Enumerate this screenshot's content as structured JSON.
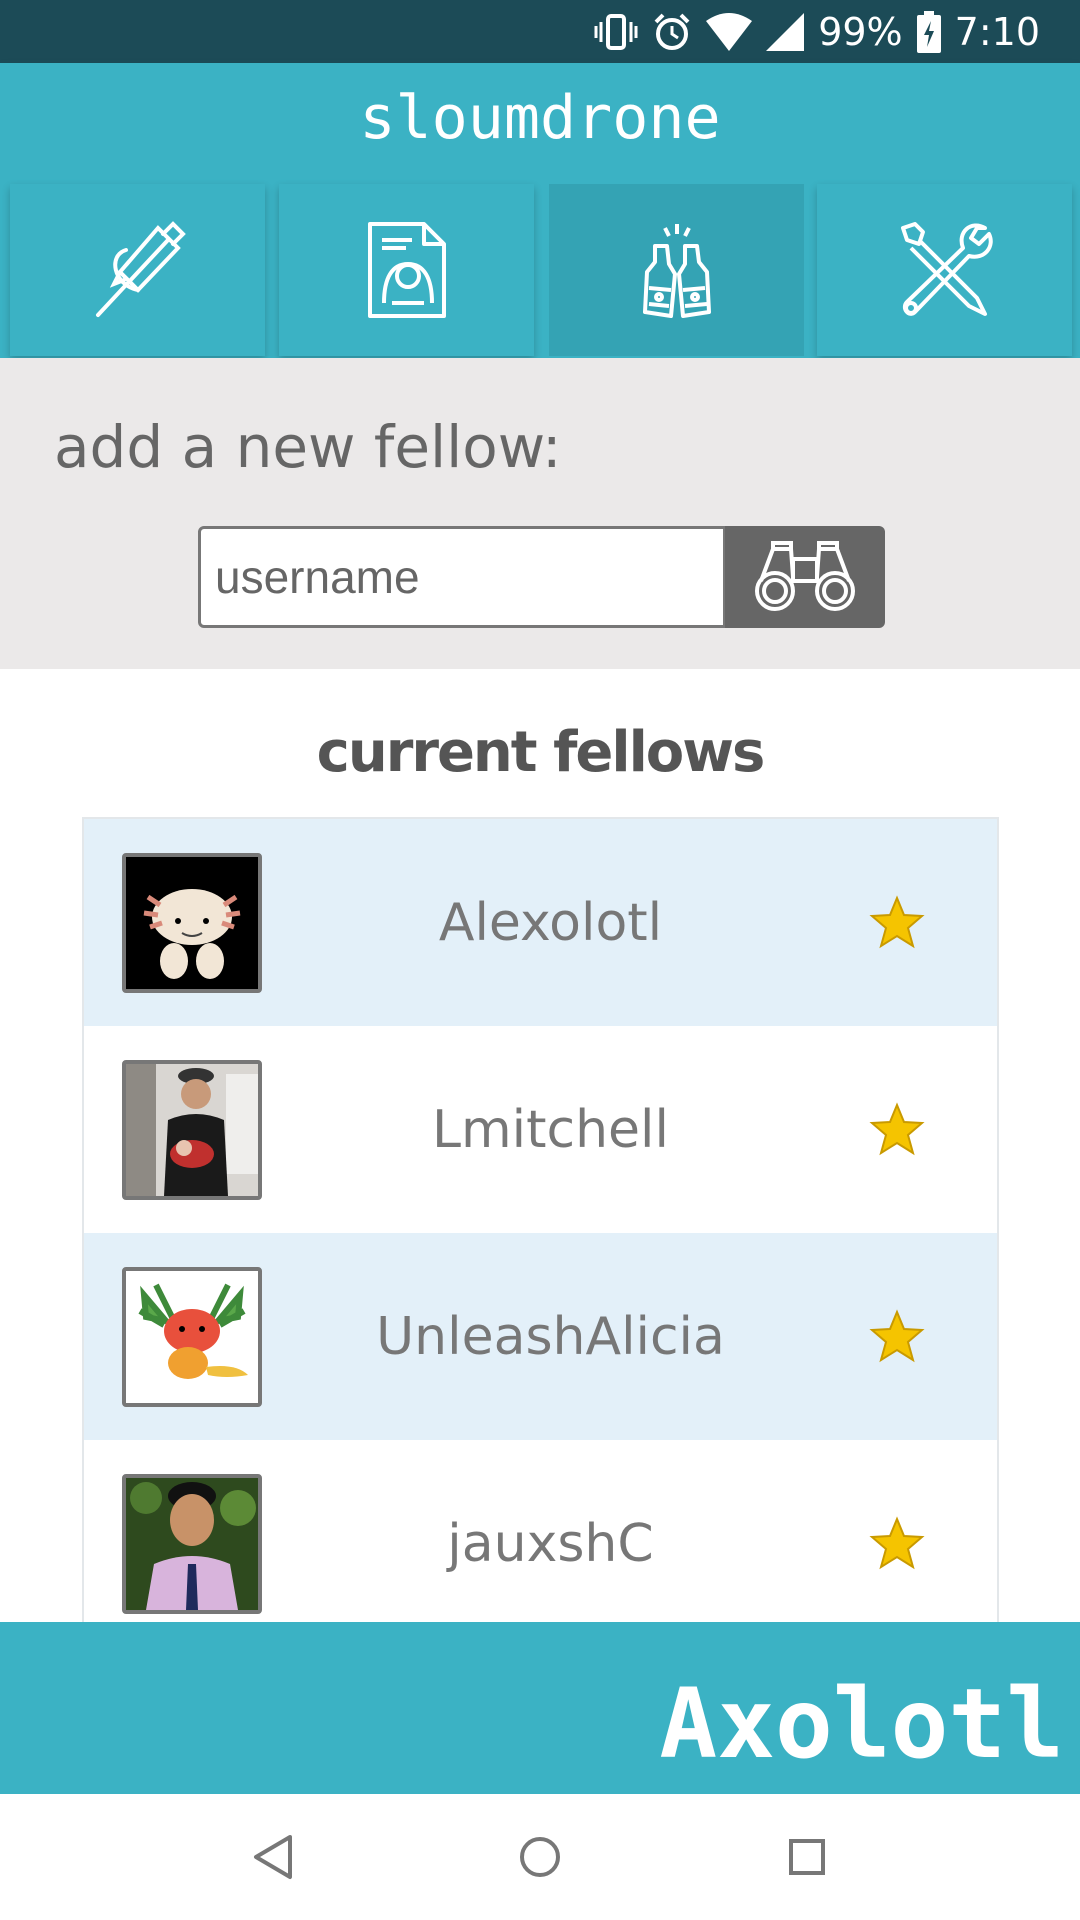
{
  "status_bar": {
    "battery": "99%",
    "time": "7:10"
  },
  "app": {
    "title": "sloumdrone"
  },
  "tabs": [
    {
      "name": "tab-sketch",
      "icon": "pen-sketch-icon"
    },
    {
      "name": "tab-profile",
      "icon": "profile-document-icon"
    },
    {
      "name": "tab-fellows",
      "icon": "beer-bottles-icon",
      "active": true
    },
    {
      "name": "tab-tools",
      "icon": "tools-icon"
    }
  ],
  "add_fellow": {
    "label": "add a new fellow:",
    "input_placeholder": "username",
    "input_value": "",
    "search_icon": "binoculars-icon"
  },
  "fellows": {
    "title": "current fellows",
    "items": [
      {
        "name": "Alexolotl",
        "favorite": true
      },
      {
        "name": "Lmitchell",
        "favorite": true
      },
      {
        "name": "UnleashAlicia",
        "favorite": true
      },
      {
        "name": "jauxshC",
        "favorite": true
      }
    ]
  },
  "footer": {
    "text": "Axolotl"
  },
  "colors": {
    "primary": "#3bb2c4",
    "status_bar": "#1c4b57",
    "row_shaded": "#e3f0f9",
    "star": "#f5c400"
  }
}
